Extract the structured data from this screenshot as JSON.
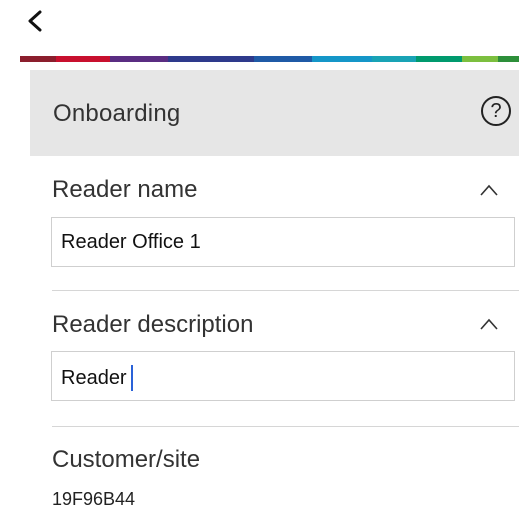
{
  "nav": {
    "back_icon": "chevron-left-icon"
  },
  "brand_bar_colors": [
    "#8b1e2d",
    "#c8102e",
    "#5a2d82",
    "#2e3a8c",
    "#1f5aa6",
    "#1596c8",
    "#19a3b5",
    "#009a6e",
    "#7cbf3f",
    "#2d8f3a"
  ],
  "header": {
    "title": "Onboarding",
    "help_label": "?"
  },
  "reader_name": {
    "label": "Reader name",
    "value": "Reader Office 1"
  },
  "reader_description": {
    "label": "Reader description",
    "value": "Reader"
  },
  "customer_site": {
    "label": "Customer/site",
    "value": "19F96B44"
  },
  "colors": {
    "header_bg": "#e6e6e6",
    "caret": "#2a62d8"
  }
}
